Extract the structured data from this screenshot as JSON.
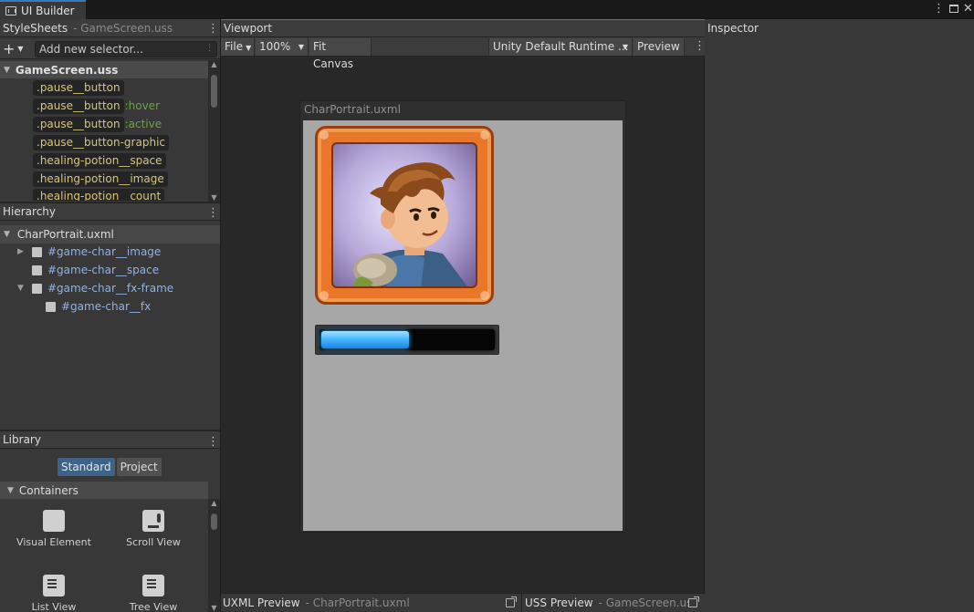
{
  "window": {
    "tab_title": "UI Builder"
  },
  "stylesheets": {
    "title": "StyleSheets",
    "subtitle": "GameScreen.uss",
    "add_placeholder": "Add new selector...",
    "file_name": "GameScreen.uss",
    "selectors": [
      {
        "name": ".pause__button",
        "pseudo": ""
      },
      {
        "name": ".pause__button",
        "pseudo": ":hover"
      },
      {
        "name": ".pause__button",
        "pseudo": ":active"
      },
      {
        "name": ".pause__button-graphic",
        "pseudo": ""
      },
      {
        "name": ".healing-potion__space",
        "pseudo": ""
      },
      {
        "name": ".healing-potion__image",
        "pseudo": ""
      },
      {
        "name": ".healing-potion__count",
        "pseudo": ""
      }
    ]
  },
  "hierarchy": {
    "title": "Hierarchy",
    "root": "CharPortrait.uxml",
    "items": [
      {
        "label": "#game-char__image",
        "expanded": false,
        "has_children": true,
        "depth": 1
      },
      {
        "label": "#game-char__space",
        "expanded": false,
        "has_children": false,
        "depth": 1
      },
      {
        "label": "#game-char__fx-frame",
        "expanded": true,
        "has_children": true,
        "depth": 1
      },
      {
        "label": "#game-char__fx",
        "expanded": false,
        "has_children": false,
        "depth": 2
      }
    ]
  },
  "library": {
    "title": "Library",
    "tabs": [
      {
        "label": "Standard",
        "active": true
      },
      {
        "label": "Project",
        "active": false
      }
    ],
    "section": "Containers",
    "items": [
      {
        "label": "Visual Element",
        "icon": "visual-element-icon"
      },
      {
        "label": "Scroll View",
        "icon": "scroll-view-icon"
      },
      {
        "label": "List View",
        "icon": "list-view-icon"
      },
      {
        "label": "Tree View",
        "icon": "tree-view-icon"
      }
    ]
  },
  "viewport": {
    "title": "Viewport",
    "toolbar": {
      "file": "File",
      "zoom": "100%",
      "fit_canvas": "Fit Canvas",
      "theme": "Unity Default Runtime ...",
      "preview": "Preview"
    },
    "canvas_title": "CharPortrait.uxml",
    "health_fraction": 0.52,
    "footer": {
      "uxml_label": "UXML Preview",
      "uxml_file": "CharPortrait.uxml",
      "uss_label": "USS Preview",
      "uss_file": "GameScreen.uss"
    }
  },
  "inspector": {
    "title": "Inspector"
  },
  "colors": {
    "accent": "#3a79bb",
    "selector_text": "#d6c67b",
    "pseudo_text": "#6aa443",
    "hierarchy_text": "#8fb2e4",
    "portrait_frame": "#e8772a",
    "health_fill": "#49b8ff"
  }
}
